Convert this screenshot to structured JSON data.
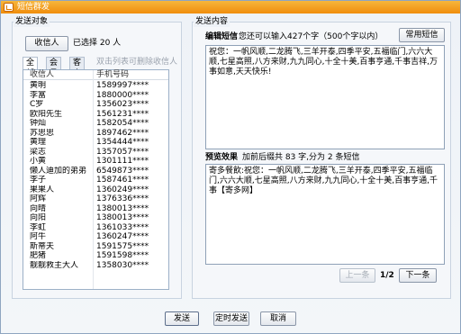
{
  "window": {
    "title": "短信群发"
  },
  "left": {
    "group_title": "发送对象",
    "recipient_button": "收信人",
    "selected_count": "已选择 20 人",
    "tabs": [
      "全部",
      "会员",
      "客户"
    ],
    "hint": "双击列表可删除收信人",
    "columns": [
      "收信人",
      "手机号码"
    ],
    "rows": [
      [
        "黄明",
        "1589997****"
      ],
      [
        "李富",
        "1880000****"
      ],
      [
        "C罗",
        "1356023****"
      ],
      [
        "欧阳先生",
        "1561231****"
      ],
      [
        "钟灿",
        "1582054****"
      ],
      [
        "苏思思",
        "1897462****"
      ],
      [
        "黄理",
        "1354444****"
      ],
      [
        "梁志",
        "1357057****"
      ],
      [
        "小黄",
        "1301111****"
      ],
      [
        "懒人迪加的弟弟",
        "6549873****"
      ],
      [
        "李子",
        "1587461****"
      ],
      [
        "果果人",
        "1360249****"
      ],
      [
        "阿辉",
        "1376336****"
      ],
      [
        "向晴",
        "1380013****"
      ],
      [
        "向阳",
        "1380013****"
      ],
      [
        "李虹",
        "1361033****"
      ],
      [
        "阿牛",
        "1360247****"
      ],
      [
        "斯蒂夫",
        "1591575****"
      ],
      [
        "肥猪",
        "1591598****"
      ],
      [
        "靓靓救主大人",
        "1358030****"
      ]
    ]
  },
  "right": {
    "group_title": "发送内容",
    "edit_label": "编辑短信",
    "edit_hint": "您还可以输入427个字（500个字以内）",
    "common_button": "常用短信",
    "message_text": "祝您：一帆风顺,二龙腾飞,三羊开泰,四季平安,五福临门,六六大顺,七星高照,八方来财,九九同心,十全十美,百事亨通,千事吉祥,万事如意,天天快乐!",
    "preview_label": "预览效果",
    "preview_hint": "加前后缀共 83 字,分为 2 条短信",
    "preview_text": "寄多餐飲:祝您：一帆风顺,二龙腾飞,三羊开泰,四季平安,五福临门,六六大顺,七星高照,八方来财,九九同心,十全十美,百事亨通,千事【寄多网】",
    "prev_button": "上一条",
    "page": "1/2",
    "next_button": "下一条"
  },
  "footer": {
    "send": "发送",
    "scheduled_send": "定时发送",
    "cancel": "取消"
  }
}
